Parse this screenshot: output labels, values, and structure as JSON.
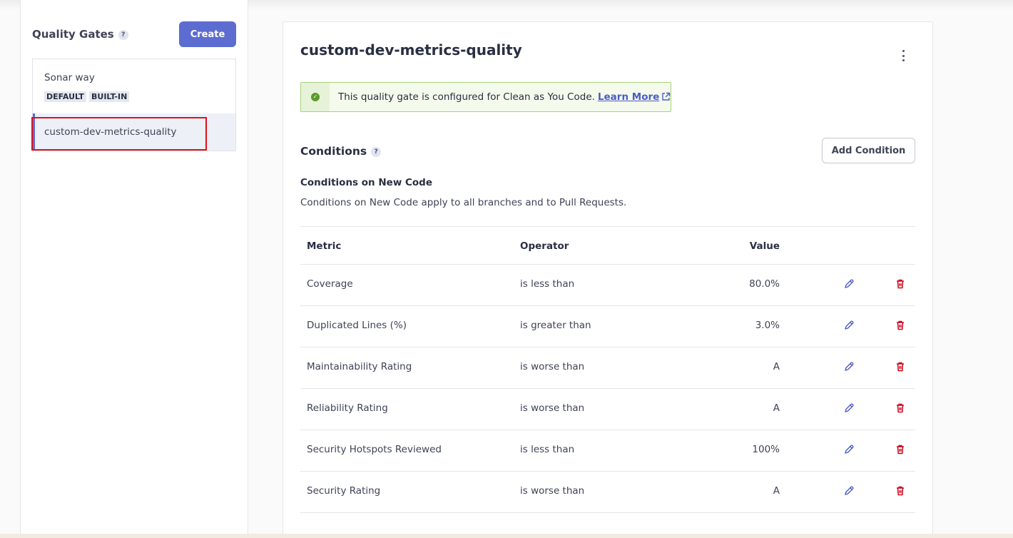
{
  "sidebar": {
    "title": "Quality Gates",
    "help_icon": "?",
    "create_label": "Create",
    "gates": [
      {
        "name": "Sonar way",
        "tags": [
          "DEFAULT",
          "BUILT-IN"
        ]
      },
      {
        "name": "custom-dev-metrics-quality",
        "selected": true
      }
    ]
  },
  "main": {
    "gate_title": "custom-dev-metrics-quality",
    "menu_icon": "kebab-menu-icon",
    "banner": {
      "text": "This quality gate is configured for Clean as You Code.",
      "link_label": "Learn More",
      "icon": "check-circle-icon"
    },
    "conditions": {
      "title": "Conditions",
      "help_icon": "?",
      "add_label": "Add Condition",
      "subtitle": "Conditions on New Code",
      "description": "Conditions on New Code apply to all branches and to Pull Requests.",
      "columns": {
        "metric": "Metric",
        "operator": "Operator",
        "value": "Value"
      },
      "rows": [
        {
          "metric": "Coverage",
          "operator": "is less than",
          "value": "80.0%"
        },
        {
          "metric": "Duplicated Lines (%)",
          "operator": "is greater than",
          "value": "3.0%"
        },
        {
          "metric": "Maintainability Rating",
          "operator": "is worse than",
          "value": "A"
        },
        {
          "metric": "Reliability Rating",
          "operator": "is worse than",
          "value": "A"
        },
        {
          "metric": "Security Hotspots Reviewed",
          "operator": "is less than",
          "value": "100%"
        },
        {
          "metric": "Security Rating",
          "operator": "is worse than",
          "value": "A"
        }
      ]
    }
  },
  "colors": {
    "accent": "#5d6cd0",
    "success_border": "#a8d17a",
    "delete": "#d0021b",
    "highlight_box": "#e0101a"
  }
}
